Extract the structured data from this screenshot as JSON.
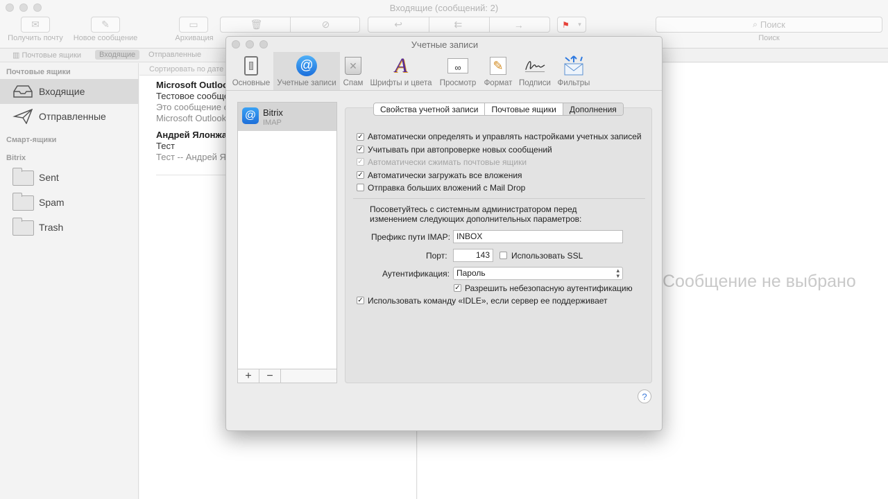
{
  "window": {
    "title": "Входящие (сообщений: 2)"
  },
  "toolbar": {
    "get_mail": "Получить почту",
    "new_message": "Новое сообщение",
    "archive": "Архивация",
    "search_placeholder": "Поиск",
    "search_label": "Поиск"
  },
  "favorites": {
    "mailboxes": "Почтовые ящики",
    "inbox": "Входящие",
    "sent": "Отправленные"
  },
  "sidebar": {
    "mailboxes_header": "Почтовые ящики",
    "inbox": "Входящие",
    "sent": "Отправленные",
    "smart_header": "Смарт-ящики",
    "account_header": "Bitrix",
    "folders": [
      "Sent",
      "Spam",
      "Trash"
    ]
  },
  "message_list": {
    "sort_label": "Сортировать по дате",
    "messages": [
      {
        "from": "Microsoft Outlook",
        "subject": "Тестовое сообщение",
        "preview1": "Это сообщение с",
        "preview2": "Microsoft Outlook"
      },
      {
        "from": "Андрей Ялонжа",
        "subject": "Тест",
        "preview1": "Тест -- Андрей Ял"
      }
    ]
  },
  "viewer": {
    "no_selection": "Сообщение не выбрано"
  },
  "dialog": {
    "title": "Учетные записи",
    "tools": [
      "Основные",
      "Учетные записи",
      "Спам",
      "Шрифты и цвета",
      "Просмотр",
      "Формат",
      "Подписи",
      "Фильтры"
    ],
    "account": {
      "name": "Bitrix",
      "type": "IMAP"
    },
    "list_buttons": {
      "add": "+",
      "remove": "−"
    },
    "tabs": [
      "Свойства учетной записи",
      "Почтовые ящики",
      "Дополнения"
    ],
    "active_tab": "Дополнения",
    "checkboxes": [
      {
        "label": "Автоматически определять и управлять настройками учетных записей",
        "checked": true,
        "disabled": false
      },
      {
        "label": "Учитывать при автопроверке новых сообщений",
        "checked": true,
        "disabled": false
      },
      {
        "label": "Автоматически сжимать почтовые ящики",
        "checked": true,
        "disabled": true
      },
      {
        "label": "Автоматически загружать все вложения",
        "checked": true,
        "disabled": false
      },
      {
        "label": "Отправка больших вложений с Mail Drop",
        "checked": false,
        "disabled": false
      }
    ],
    "advice_line1": "Посоветуйтесь с системным администратором перед",
    "advice_line2": "изменением следующих дополнительных параметров:",
    "imap_prefix_label": "Префикс пути IMAP:",
    "imap_prefix_value": "INBOX",
    "port_label": "Порт:",
    "port_value": "143",
    "ssl_label": "Использовать SSL",
    "ssl_checked": false,
    "auth_label": "Аутентификация:",
    "auth_value": "Пароль",
    "insecure_auth_label": "Разрешить небезопасную аутентификацию",
    "insecure_auth_checked": true,
    "idle_label": "Использовать команду «IDLE», если сервер ее поддерживает",
    "idle_checked": true,
    "help": "?"
  },
  "colors": {
    "accent": "#3d7bd9",
    "flag": "#e8433a"
  }
}
